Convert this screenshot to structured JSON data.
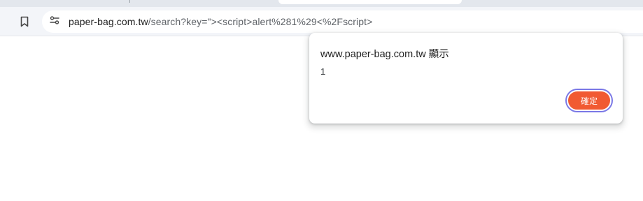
{
  "browser": {
    "toolbar": {
      "bookmark_icon": "bookmark-outline-icon",
      "site_info_icon": "tune-icon"
    },
    "omnibox": {
      "url_host": "paper-bag.com.tw",
      "url_path": "/search?key=\"><script>alert%281%29<%2Fscript>"
    }
  },
  "dialog": {
    "title": "www.paper-bag.com.tw 顯示",
    "message": "1",
    "ok_label": "確定",
    "ok_color": "#f15a32",
    "focus_ring_color": "#7a78e6"
  }
}
